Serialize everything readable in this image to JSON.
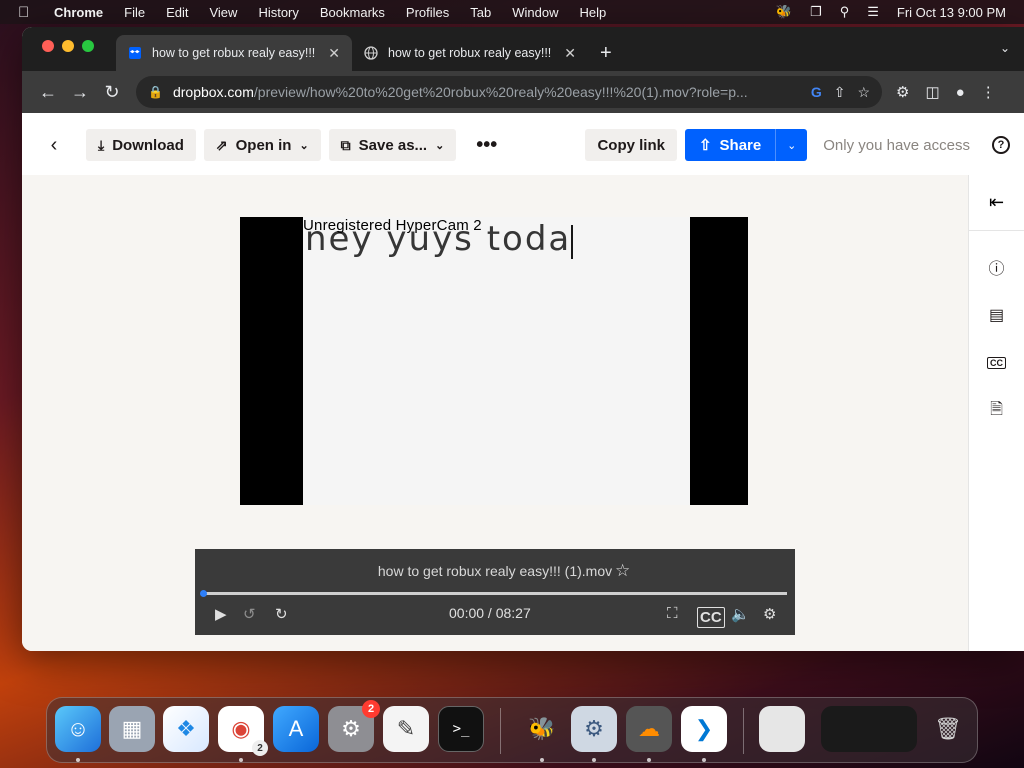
{
  "menubar": {
    "app": "Chrome",
    "items": [
      "File",
      "Edit",
      "View",
      "History",
      "Bookmarks",
      "Profiles",
      "Tab",
      "Window",
      "Help"
    ],
    "clock": "Fri Oct 13  9:00 PM"
  },
  "tabs": [
    {
      "title": "how to get robux realy easy!!!",
      "favicon": "dropbox-icon",
      "active": true
    },
    {
      "title": "how to get robux realy easy!!!",
      "favicon": "globe-icon",
      "active": false
    }
  ],
  "address_bar": {
    "host": "dropbox.com",
    "path": "/preview/how%20to%20get%20robux%20realy%20easy!!!%20(1).mov?role=p..."
  },
  "dropbox_header": {
    "download_label": "Download",
    "open_in_label": "Open in",
    "save_as_label": "Save as...",
    "copy_link_label": "Copy link",
    "share_label": "Share",
    "access_label": "Only you have access"
  },
  "video": {
    "watermark": "Unregistered HyperCam 2",
    "typed_text": "ney yuys toda",
    "file_name": "how to get robux realy easy!!! (1).mov",
    "current_time": "00:00",
    "duration": "08:27",
    "time_display": "00:00 / 08:27",
    "progress_fraction": 0
  },
  "dock": {
    "settings_badge": "2",
    "chrome_badge": "2"
  },
  "colors": {
    "share_blue": "#0061fe",
    "progress_knob": "#2d7ff9"
  }
}
